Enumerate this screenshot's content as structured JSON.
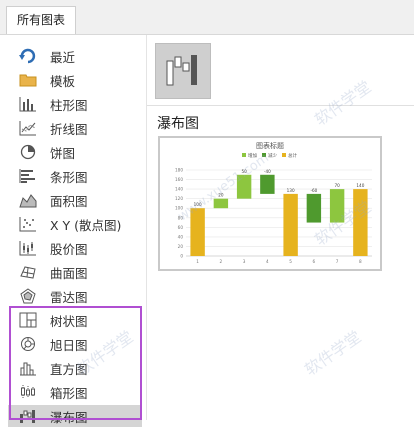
{
  "tabs": {
    "all_charts": "所有图表"
  },
  "sidebar": {
    "items": [
      {
        "label": "最近",
        "icon": "recent-arrow-icon"
      },
      {
        "label": "模板",
        "icon": "folder-icon"
      },
      {
        "label": "柱形图",
        "icon": "column-chart-icon"
      },
      {
        "label": "折线图",
        "icon": "line-chart-icon"
      },
      {
        "label": "饼图",
        "icon": "pie-chart-icon"
      },
      {
        "label": "条形图",
        "icon": "bar-chart-icon"
      },
      {
        "label": "面积图",
        "icon": "area-chart-icon"
      },
      {
        "label": "X Y (散点图)",
        "icon": "scatter-chart-icon"
      },
      {
        "label": "股价图",
        "icon": "stock-chart-icon"
      },
      {
        "label": "曲面图",
        "icon": "surface-chart-icon"
      },
      {
        "label": "雷达图",
        "icon": "radar-chart-icon"
      },
      {
        "label": "树状图",
        "icon": "treemap-icon"
      },
      {
        "label": "旭日图",
        "icon": "sunburst-icon"
      },
      {
        "label": "直方图",
        "icon": "histogram-icon"
      },
      {
        "label": "箱形图",
        "icon": "box-whisker-icon"
      },
      {
        "label": "瀑布图",
        "icon": "waterfall-icon",
        "selected": true
      }
    ],
    "highlight_color": "#b04fd2"
  },
  "main": {
    "chart_type_name": "瀑布图"
  },
  "chart_data": {
    "type": "bar",
    "subtype": "waterfall",
    "title": "图表标题",
    "legend": [
      "增加",
      "减少",
      "总计"
    ],
    "legend_position": "top",
    "categories": [
      "1",
      "2",
      "3",
      "4",
      "5",
      "6",
      "7",
      "8"
    ],
    "values": [
      100,
      20,
      50,
      -40,
      130,
      -60,
      70,
      140
    ],
    "data_labels": [
      "100",
      "20",
      "50",
      "-40",
      "130",
      "-60",
      "70",
      "140"
    ],
    "kinds": [
      "total",
      "increase",
      "increase",
      "decrease",
      "total",
      "decrease",
      "increase",
      "total"
    ],
    "yticks": [
      0,
      20,
      40,
      60,
      80,
      100,
      120,
      140,
      160,
      180
    ],
    "ylim": [
      0,
      180
    ],
    "grid": true,
    "colors": {
      "increase": "#8dc63f",
      "decrease": "#4f9a2e",
      "total": "#e6b31e"
    }
  },
  "watermark": "软件学堂",
  "watermark_url": "www.xue51.com"
}
